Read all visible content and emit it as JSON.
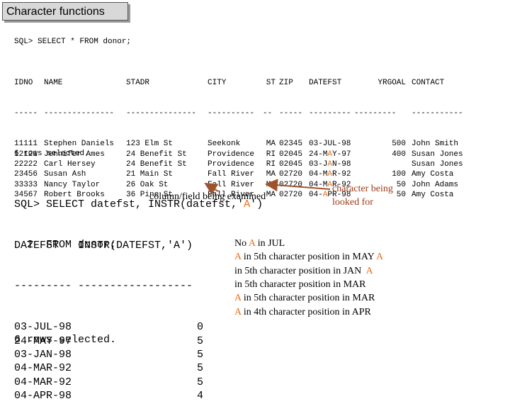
{
  "title": "Character functions",
  "query1": "SQL> SELECT * FROM donor;",
  "table": {
    "headers": [
      "IDNO",
      "NAME",
      "STADR",
      "CITY",
      "ST",
      "ZIP",
      "DATEFST",
      "YRGOAL",
      "CONTACT"
    ],
    "dashes": [
      "-----",
      "---------------",
      "---------------",
      "----------",
      "--",
      "-----",
      "---------",
      "---------",
      "-----------"
    ],
    "rows": [
      {
        "idno": "11111",
        "name": "Stephen Daniels",
        "stadr": "123 Elm St",
        "city": "Seekonk",
        "st": "MA",
        "zip": "02345",
        "date_pre": "03-JUL-98",
        "date_hl": "",
        "date_post": "",
        "yrgoal": "500",
        "contact": "John Smith"
      },
      {
        "idno": "12121",
        "name": "Jennifer Ames",
        "stadr": "24 Benefit St",
        "city": "Providence",
        "st": "RI",
        "zip": "02045",
        "date_pre": "24-M",
        "date_hl": "A",
        "date_post": "Y-97",
        "yrgoal": "400",
        "contact": "Susan Jones"
      },
      {
        "idno": "22222",
        "name": "Carl Hersey",
        "stadr": "24 Benefit St",
        "city": "Providence",
        "st": "RI",
        "zip": "02045",
        "date_pre": "03-J",
        "date_hl": "A",
        "date_post": "N-98",
        "yrgoal": "",
        "contact": "Susan Jones"
      },
      {
        "idno": "23456",
        "name": "Susan Ash",
        "stadr": "21 Main St",
        "city": "Fall River",
        "st": "MA",
        "zip": "02720",
        "date_pre": "04-M",
        "date_hl": "A",
        "date_post": "R-92",
        "yrgoal": "100",
        "contact": "Amy Costa"
      },
      {
        "idno": "33333",
        "name": "Nancy Taylor",
        "stadr": "26 Oak St",
        "city": "Fall River",
        "st": "MA",
        "zip": "02720",
        "date_pre": "04-M",
        "date_hl": "A",
        "date_post": "R-92",
        "yrgoal": "50",
        "contact": "John Adams"
      },
      {
        "idno": "34567",
        "name": "Robert Brooks",
        "stadr": "36 Pine St",
        "city": "Fall River",
        "st": "MA",
        "zip": "02720",
        "date_pre": "04-",
        "date_hl": "A",
        "date_post": "PR-98",
        "yrgoal": "50",
        "contact": "Amy Costa"
      }
    ]
  },
  "rows_selected_1": "6 rows selected.",
  "query2": {
    "line1_pre": "SQL> SELECT datefst, INSTR(",
    "line1_field": "datefst",
    "line1_mid": ",'",
    "line1_char": "A",
    "line1_post": "')",
    "line2": "  2  FROM donor;"
  },
  "annotations": {
    "field_label": "column/field being examined",
    "char_label_1": "character being",
    "char_label_2": "looked for"
  },
  "result": {
    "headers": [
      "DATEFST",
      "INSTR(DATEFST,'A')"
    ],
    "dashes": [
      "---------",
      "------------------"
    ],
    "rows": [
      {
        "date": "03-JUL-98",
        "pos": "0",
        "note_pre": "No ",
        "note_hl": "A",
        "note_post": " in JUL",
        "note_tail": ""
      },
      {
        "date": "24-MAY-97",
        "pos": "5",
        "note_pre": "",
        "note_hl": "A",
        "note_post": " in 5th character position in MAY ",
        "note_tail": "A"
      },
      {
        "date": "03-JAN-98",
        "pos": "5",
        "note_pre": "in 5th character position in JAN  ",
        "note_hl": "A",
        "note_post": "",
        "note_tail": ""
      },
      {
        "date": "04-MAR-92",
        "pos": "5",
        "note_pre": "in 5th character position in MAR",
        "note_hl": "",
        "note_post": "",
        "note_tail": ""
      },
      {
        "date": "04-MAR-92",
        "pos": "5",
        "note_pre": "",
        "note_hl": "A",
        "note_post": " in 5th character position in MAR",
        "note_tail": ""
      },
      {
        "date": "04-APR-98",
        "pos": "4",
        "note_pre": "",
        "note_hl": "A",
        "note_post": " in 4th character position in APR",
        "note_tail": ""
      }
    ]
  },
  "rows_selected_2": "6 rows selected.",
  "colors": {
    "highlight": "#e8711a",
    "annotation": "#9a3b15",
    "arrow": "#a0522d"
  }
}
